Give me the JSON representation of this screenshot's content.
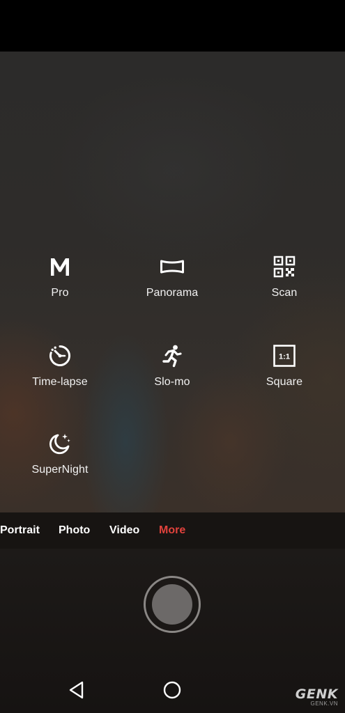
{
  "modes": [
    {
      "label": "Pro",
      "icon": "pro-m-icon"
    },
    {
      "label": "Panorama",
      "icon": "panorama-icon"
    },
    {
      "label": "Scan",
      "icon": "qr-scan-icon"
    },
    {
      "label": "Time-lapse",
      "icon": "timelapse-icon"
    },
    {
      "label": "Slo-mo",
      "icon": "running-person-icon"
    },
    {
      "label": "Square",
      "icon": "square-ratio-icon"
    },
    {
      "label": "SuperNight",
      "icon": "moon-stars-icon"
    }
  ],
  "square_icon_text": "1:1",
  "tabs": [
    {
      "label": "Portrait"
    },
    {
      "label": "Photo"
    },
    {
      "label": "Video"
    },
    {
      "label": "More",
      "active": true
    }
  ],
  "active_color": "#e0423c",
  "navigation": {
    "back_icon": "back-triangle-icon",
    "home_icon": "home-circle-icon"
  },
  "watermark": {
    "main": "GENK",
    "sub": "GENK.VN"
  }
}
